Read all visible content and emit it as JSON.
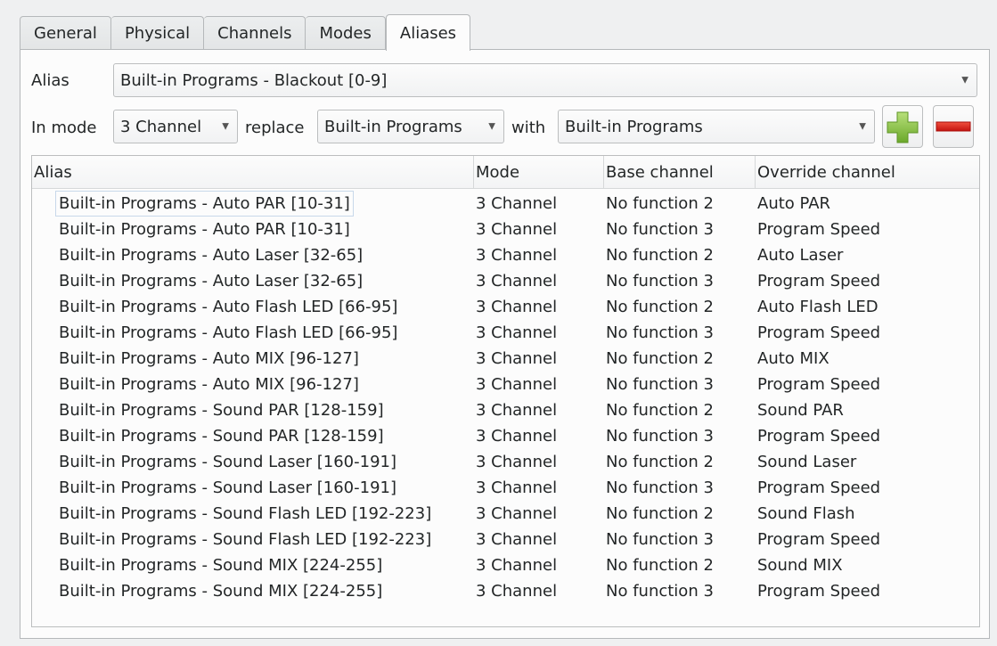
{
  "tabs": [
    "General",
    "Physical",
    "Channels",
    "Modes",
    "Aliases"
  ],
  "active_tab": "Aliases",
  "alias": {
    "label": "Alias",
    "value": "Built-in Programs - Blackout [0-9]"
  },
  "mode_row": {
    "in_mode_label": "In mode",
    "mode_value": "3 Channel",
    "replace_label": "replace",
    "replace_value": "Built-in Programs",
    "with_label": "with",
    "with_value": "Built-in Programs"
  },
  "buttons": {
    "add_icon": "plus-icon",
    "remove_icon": "minus-icon",
    "add_color": "#8cc63f",
    "remove_color": "#e0201e"
  },
  "table": {
    "columns": [
      "Alias",
      "Mode",
      "Base channel",
      "Override channel"
    ],
    "rows": [
      [
        "Built-in Programs - Auto PAR [10-31]",
        "3 Channel",
        "No function 2",
        "Auto PAR"
      ],
      [
        "Built-in Programs - Auto PAR [10-31]",
        "3 Channel",
        "No function 3",
        "Program Speed"
      ],
      [
        "Built-in Programs - Auto Laser [32-65]",
        "3 Channel",
        "No function 2",
        "Auto Laser"
      ],
      [
        "Built-in Programs - Auto Laser [32-65]",
        "3 Channel",
        "No function 3",
        "Program Speed"
      ],
      [
        "Built-in Programs - Auto Flash LED [66-95]",
        "3 Channel",
        "No function 2",
        "Auto Flash LED"
      ],
      [
        "Built-in Programs - Auto Flash LED [66-95]",
        "3 Channel",
        "No function 3",
        "Program Speed"
      ],
      [
        "Built-in Programs - Auto MIX [96-127]",
        "3 Channel",
        "No function 2",
        "Auto MIX"
      ],
      [
        "Built-in Programs - Auto MIX [96-127]",
        "3 Channel",
        "No function 3",
        "Program Speed"
      ],
      [
        "Built-in Programs - Sound PAR [128-159]",
        "3 Channel",
        "No function 2",
        "Sound PAR"
      ],
      [
        "Built-in Programs - Sound PAR [128-159]",
        "3 Channel",
        "No function 3",
        "Program Speed"
      ],
      [
        "Built-in Programs - Sound Laser [160-191]",
        "3 Channel",
        "No function 2",
        "Sound Laser"
      ],
      [
        "Built-in Programs - Sound Laser [160-191]",
        "3 Channel",
        "No function 3",
        "Program Speed"
      ],
      [
        "Built-in Programs - Sound Flash LED [192-223]",
        "3 Channel",
        "No function 2",
        "Sound Flash"
      ],
      [
        "Built-in Programs - Sound Flash LED [192-223]",
        "3 Channel",
        "No function 3",
        "Program Speed"
      ],
      [
        "Built-in Programs - Sound MIX [224-255]",
        "3 Channel",
        "No function 2",
        "Sound MIX"
      ],
      [
        "Built-in Programs - Sound MIX [224-255]",
        "3 Channel",
        "No function 3",
        "Program Speed"
      ]
    ]
  }
}
